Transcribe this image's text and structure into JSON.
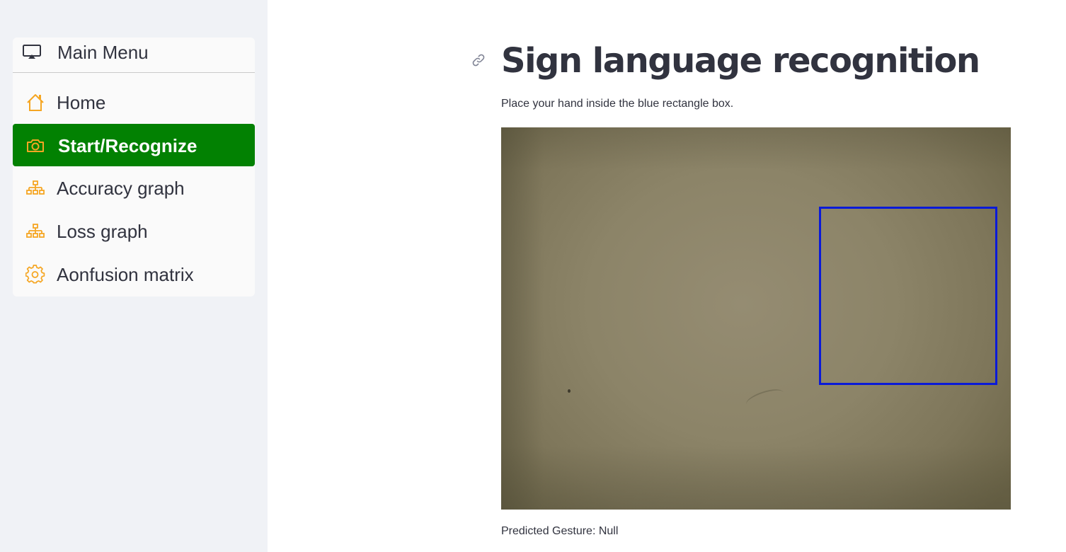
{
  "sidebar": {
    "menu_title": "Main Menu",
    "menu_icon": "monitor-icon",
    "items": [
      {
        "label": "Home",
        "icon": "house-icon",
        "active": false
      },
      {
        "label": "Start/Recognize",
        "icon": "camera-icon",
        "active": true
      },
      {
        "label": "Accuracy graph",
        "icon": "diagram-icon",
        "active": false
      },
      {
        "label": "Loss graph",
        "icon": "diagram-icon",
        "active": false
      },
      {
        "label": "Aonfusion matrix",
        "icon": "gear-icon",
        "active": false
      }
    ]
  },
  "main": {
    "title": "Sign language recognition",
    "subtitle": "Place your hand inside the blue rectangle box.",
    "prediction": "Predicted Gesture: Null"
  },
  "colors": {
    "accent_active": "#028102",
    "icon_orange": "#f5a623",
    "roi_box": "#0a1ad8",
    "sidebar_bg": "#f0f2f6",
    "text": "#31333f"
  }
}
